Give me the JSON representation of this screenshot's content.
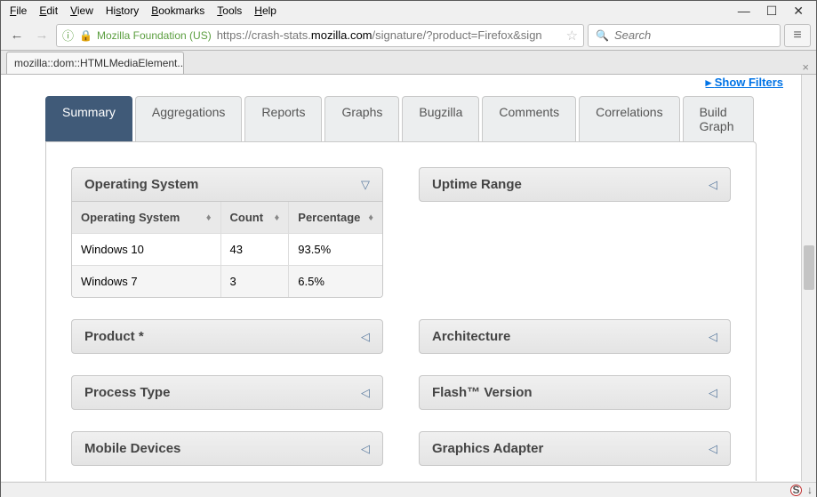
{
  "menu": {
    "items": [
      {
        "label": "File",
        "key": "F"
      },
      {
        "label": "Edit",
        "key": "E"
      },
      {
        "label": "View",
        "key": "V"
      },
      {
        "label": "History",
        "key": "S"
      },
      {
        "label": "Bookmarks",
        "key": "B"
      },
      {
        "label": "Tools",
        "key": "T"
      },
      {
        "label": "Help",
        "key": "H"
      }
    ]
  },
  "url": {
    "identity": "Mozilla Foundation (US)",
    "prefix": "https://crash-stats.",
    "domain": "mozilla.com",
    "path": "/signature/?product=Firefox&sign"
  },
  "search_placeholder": "Search",
  "tab_title": "mozilla::dom::HTMLMediaElement...",
  "show_filters_label": "Show Filters",
  "page_tabs": [
    "Summary",
    "Aggregations",
    "Reports",
    "Graphs",
    "Bugzilla",
    "Comments",
    "Correlations",
    "Build Graph"
  ],
  "active_tab_index": 0,
  "panels": {
    "left": [
      {
        "title": "Operating System",
        "expanded": true
      },
      {
        "title": "Product *",
        "expanded": false
      },
      {
        "title": "Process Type",
        "expanded": false
      },
      {
        "title": "Mobile Devices",
        "expanded": false
      }
    ],
    "right": [
      {
        "title": "Uptime Range",
        "expanded": false
      },
      {
        "title": "Architecture",
        "expanded": false
      },
      {
        "title": "Flash™ Version",
        "expanded": false
      },
      {
        "title": "Graphics Adapter",
        "expanded": false
      }
    ]
  },
  "os_table": {
    "columns": [
      "Operating System",
      "Count",
      "Percentage"
    ],
    "rows": [
      {
        "os": "Windows 10",
        "count": "43",
        "pct": "93.5%"
      },
      {
        "os": "Windows 7",
        "count": "3",
        "pct": "6.5%"
      }
    ]
  }
}
